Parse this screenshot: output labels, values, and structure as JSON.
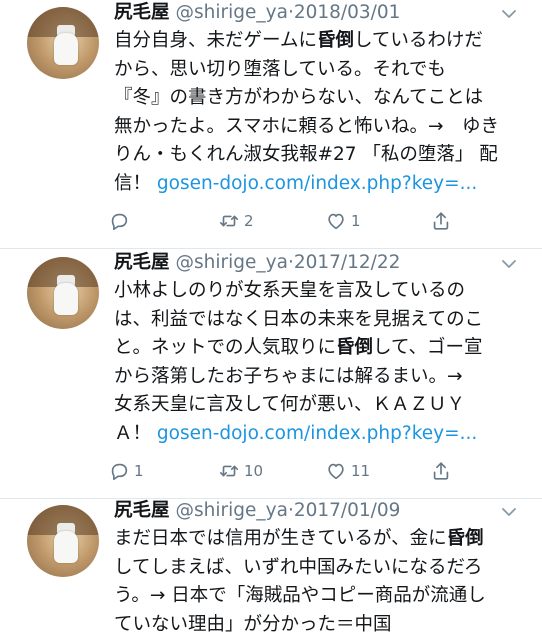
{
  "tweets": [
    {
      "name": "尻毛屋",
      "handle": "@shirige_ya",
      "dot": "·",
      "date": "2018/03/01",
      "lines": [
        [
          "自分自身、未だゲームに",
          {
            "b": "昏倒"
          },
          "しているわけだ"
        ],
        [
          "から、思い切り堕落している。それでも"
        ],
        [
          "『冬』の書き方がわからない、なんてことは"
        ],
        [
          "無かったよ。スマホに頼ると怖いね。→　ゆき"
        ],
        [
          "りん・もくれん淑女我報#27 「私の堕落」 配"
        ],
        [
          "信！ ",
          {
            "link": "gosen-dojo.com/index.php?key=..."
          }
        ]
      ],
      "counts": {
        "reply": "",
        "retweet": "2",
        "like": "1"
      }
    },
    {
      "name": "尻毛屋",
      "handle": "@shirige_ya",
      "dot": "·",
      "date": "2017/12/22",
      "lines": [
        [
          "小林よしのりが女系天皇を言及しているの"
        ],
        [
          "は、利益ではなく日本の未来を見据えてのこ"
        ],
        [
          "と。ネットでの人気取りに",
          {
            "b": "昏倒"
          },
          "して、ゴー宣"
        ],
        [
          "から落第したお子ちゃまには解るまい。→"
        ],
        [
          "女系天皇に言及して何が悪い、ＫＡＺＵＹ"
        ],
        [
          "Ａ！ ",
          {
            "link": "gosen-dojo.com/index.php?key=..."
          }
        ]
      ],
      "counts": {
        "reply": "1",
        "retweet": "10",
        "like": "11"
      }
    },
    {
      "name": "尻毛屋",
      "handle": "@shirige_ya",
      "dot": "·",
      "date": "2017/01/09",
      "lines": [
        [
          "まだ日本では信用が生きているが、金に",
          {
            "b": "昏倒"
          }
        ],
        [
          "してしまえば、いずれ中国みたいになるだろ"
        ],
        [
          "う。→ 日本で「海賊品やコピー商品が流通し"
        ],
        [
          "ていない理由」が分かった＝中国"
        ]
      ],
      "counts": null
    }
  ],
  "icons": {
    "reply": "reply-icon",
    "retweet": "retweet-icon",
    "like": "like-icon",
    "share": "share-icon",
    "menu": "chevron-down-icon",
    "avatar": "avatar"
  },
  "colors": {
    "text": "#14171a",
    "secondary": "#657786",
    "link": "#1b95e0",
    "divider": "#e1e8ed",
    "background": "#ffffff"
  }
}
